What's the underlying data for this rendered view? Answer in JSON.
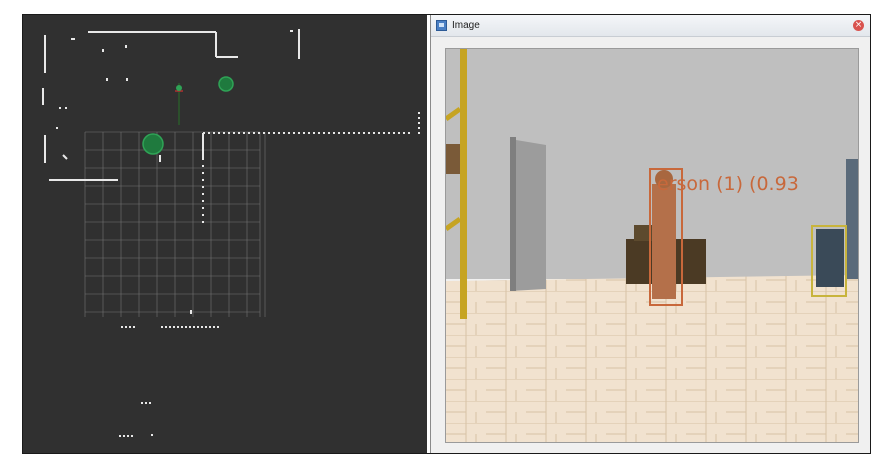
{
  "rviz_panel": {
    "name": "rviz-map-view"
  },
  "image_window": {
    "title": "Image",
    "close_symbol": "×",
    "detections": [
      {
        "label": "erson (1) (0.93",
        "color": "#c8683b"
      }
    ]
  },
  "colors": {
    "rviz_background": "#303030",
    "grid": "#8c8c8c",
    "scan_points": "#e8e8e8",
    "marker_green": "#1f7a3e",
    "person_box": "#c8683b",
    "chair_box": "#c8b43c"
  }
}
